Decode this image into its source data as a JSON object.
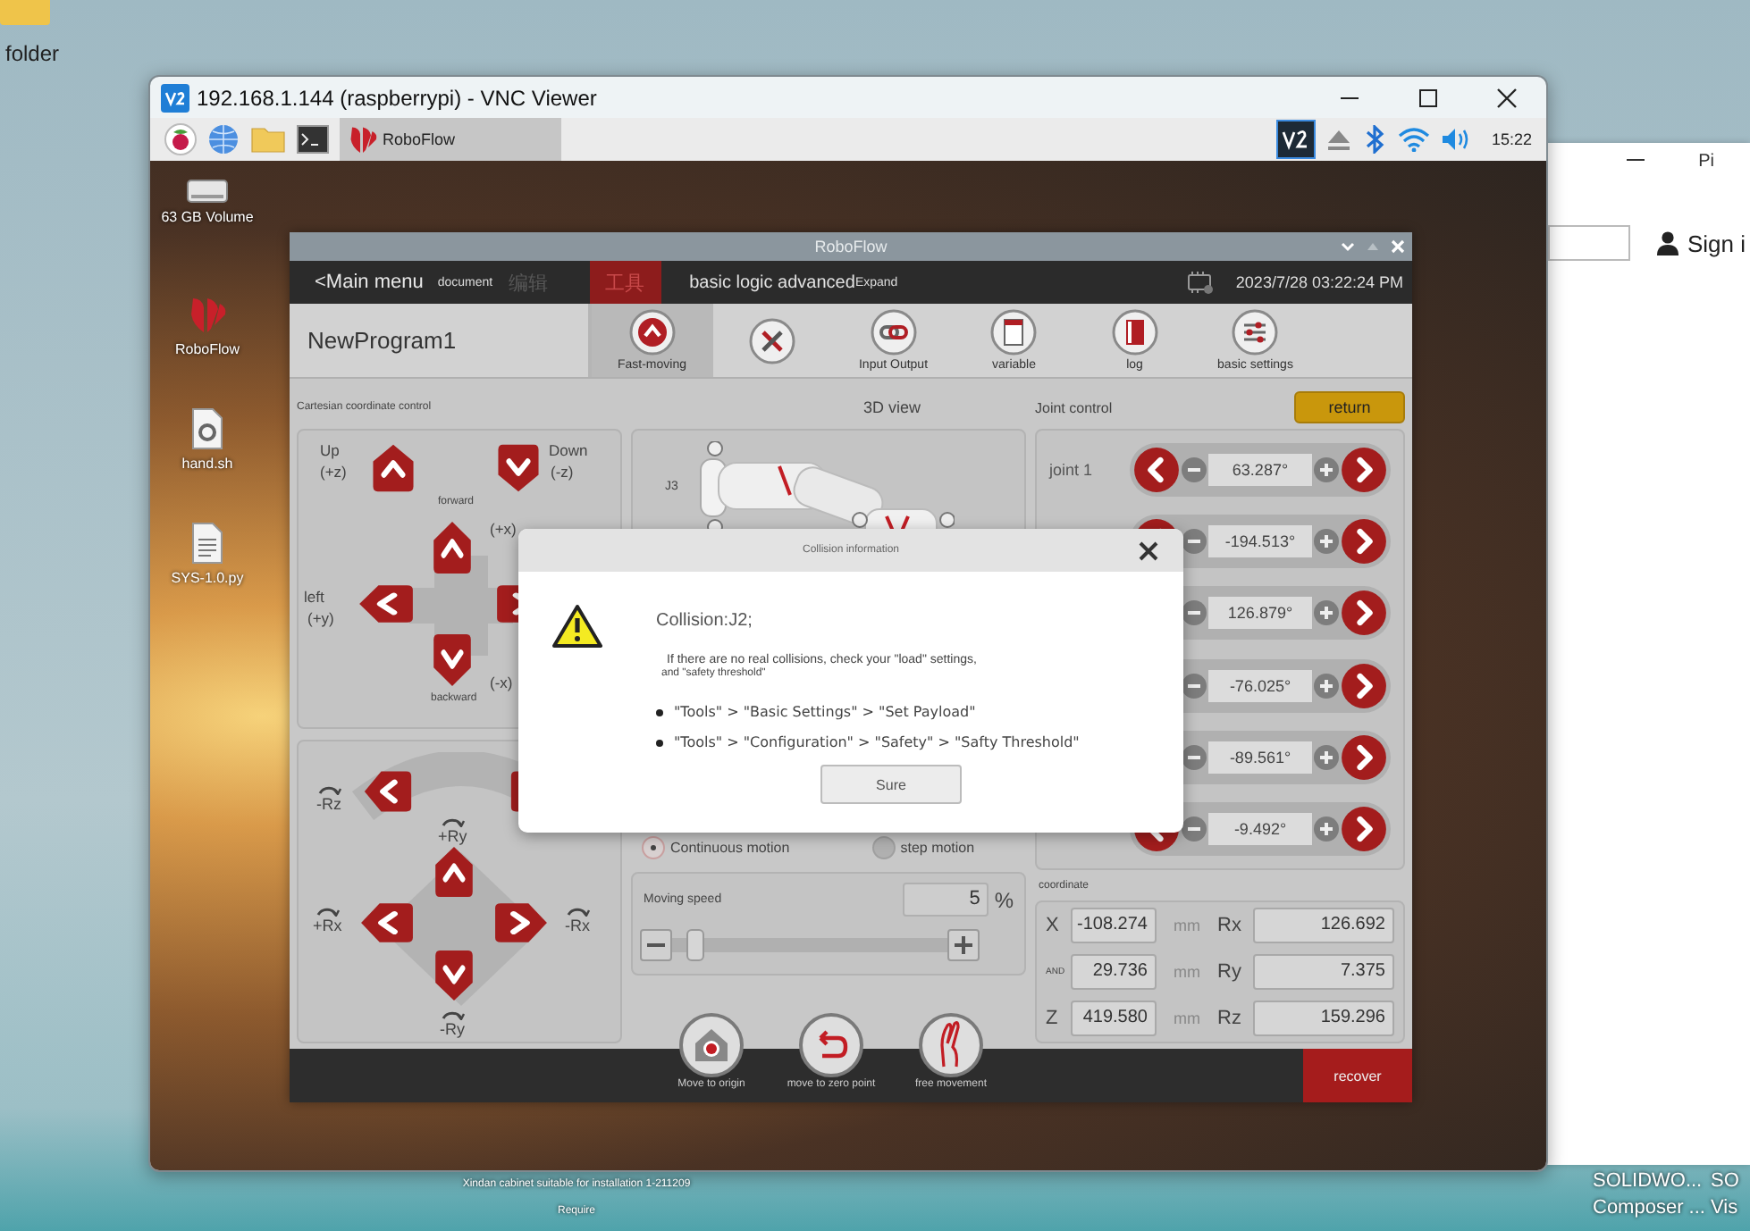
{
  "host": {
    "folder_label": "folder",
    "bottom_icon_lines": [
      "Xindan cabinet suitable for installation 1-211209",
      "Require"
    ],
    "right_icons": [
      {
        "lines": [
          "SOLIDWO...",
          "Composer ..."
        ]
      },
      {
        "lines": [
          "SO",
          "Vis"
        ]
      }
    ]
  },
  "browser": {
    "tab_title": "Pi",
    "sign_in": "Sign i"
  },
  "vnc": {
    "title": "192.168.1.144 (raspberrypi) - VNC Viewer",
    "taskbar": {
      "tasks": [
        {
          "label": "RoboFlow",
          "selected": true
        }
      ],
      "clock": "15:22"
    },
    "desktop_icons": [
      {
        "kind": "drive",
        "label": "63 GB Volume"
      },
      {
        "kind": "app",
        "label": "RoboFlow"
      },
      {
        "kind": "script",
        "label": "hand.sh"
      },
      {
        "kind": "document",
        "label": "SYS-1.0.py"
      }
    ]
  },
  "app": {
    "title": "RoboFlow",
    "back": "<Main menu",
    "menu": [
      {
        "kind": "link",
        "label": "document",
        "selected": false,
        "disabled": false
      },
      {
        "kind": "tab",
        "label": "编辑",
        "selected": false,
        "disabled": true
      },
      {
        "kind": "tab",
        "label": "工具",
        "selected": true,
        "disabled": false
      },
      {
        "kind": "mode",
        "label": "basic logic advanced",
        "selected": false,
        "disabled": false
      },
      {
        "kind": "link",
        "label": "Expand",
        "selected": false,
        "disabled": false
      }
    ],
    "datetime": "2023/7/28 03:22:24 PM",
    "program_name": "NewProgram1",
    "tools": [
      {
        "kind": "move",
        "label": "Fast-moving",
        "selected": true
      },
      {
        "kind": "tools",
        "selected": false
      },
      {
        "kind": "io",
        "label": "Input Output",
        "selected": false
      },
      {
        "kind": "variable",
        "label": "variable",
        "selected": false
      },
      {
        "kind": "log",
        "label": "log",
        "selected": false
      },
      {
        "kind": "settings",
        "label": "basic settings",
        "selected": false
      }
    ],
    "cartesian": {
      "title": "Cartesian coordinate control",
      "up": "Up",
      "up_axis": "(+z)",
      "down": "Down",
      "down_axis": "(-z)",
      "forward": "forward",
      "backward": "backward",
      "plus_x": "(+x)",
      "minus_x": "(-x)",
      "left": "left",
      "left_axis": "(+y)"
    },
    "rotation": {
      "minus_rz": "-Rz",
      "plus_ry": "+Ry",
      "plus_rx": "+Rx",
      "minus_rx": "-Rx",
      "minus_ry": "-Ry"
    },
    "view3d": {
      "title": "3D view",
      "joint_label": "J3"
    },
    "motion_modes": [
      {
        "label": "Continuous motion",
        "selected": true
      },
      {
        "label": "step motion",
        "selected": false
      }
    ],
    "speed": {
      "label": "Moving speed",
      "value": "5",
      "unit": "%",
      "level": 0.05
    },
    "joint_control": {
      "title": "Joint control",
      "return_button": "return",
      "joints": [
        {
          "label": "joint 1",
          "value": "63.287°"
        },
        {
          "value": "-194.513°"
        },
        {
          "value": "126.879°"
        },
        {
          "value": "-76.025°"
        },
        {
          "value": "-89.561°"
        },
        {
          "value": "-9.492°"
        }
      ]
    },
    "coordinates": {
      "title": "coordinate",
      "rows": [
        {
          "axis": "X",
          "value": "-108.274",
          "unit": "mm",
          "rot_axis": "Rx",
          "rot_value": "126.692"
        },
        {
          "axis": "AND",
          "value": "29.736",
          "unit": "mm",
          "rot_axis": "Ry",
          "rot_value": "7.375"
        },
        {
          "axis": "Z",
          "value": "419.580",
          "unit": "mm",
          "rot_axis": "Rz",
          "rot_value": "159.296"
        }
      ]
    },
    "actions": [
      {
        "kind": "origin",
        "label": "Move to origin"
      },
      {
        "kind": "zero",
        "label": "move to zero point"
      },
      {
        "kind": "free",
        "label": "free movement"
      }
    ],
    "recover_button": "recover",
    "dialog": {
      "title": "Collision information",
      "heading": "Collision:J2;",
      "message": "If there are no real collisions, check your \"load\" settings,",
      "message_2": "and \"safety threshold\"",
      "steps": [
        "\"Tools\" > \"Basic Settings\" > \"Set Payload\"",
        "\"Tools\" > \"Configuration\" > \"Safety\" > \"Safty Threshold\""
      ],
      "button": "Sure"
    }
  }
}
